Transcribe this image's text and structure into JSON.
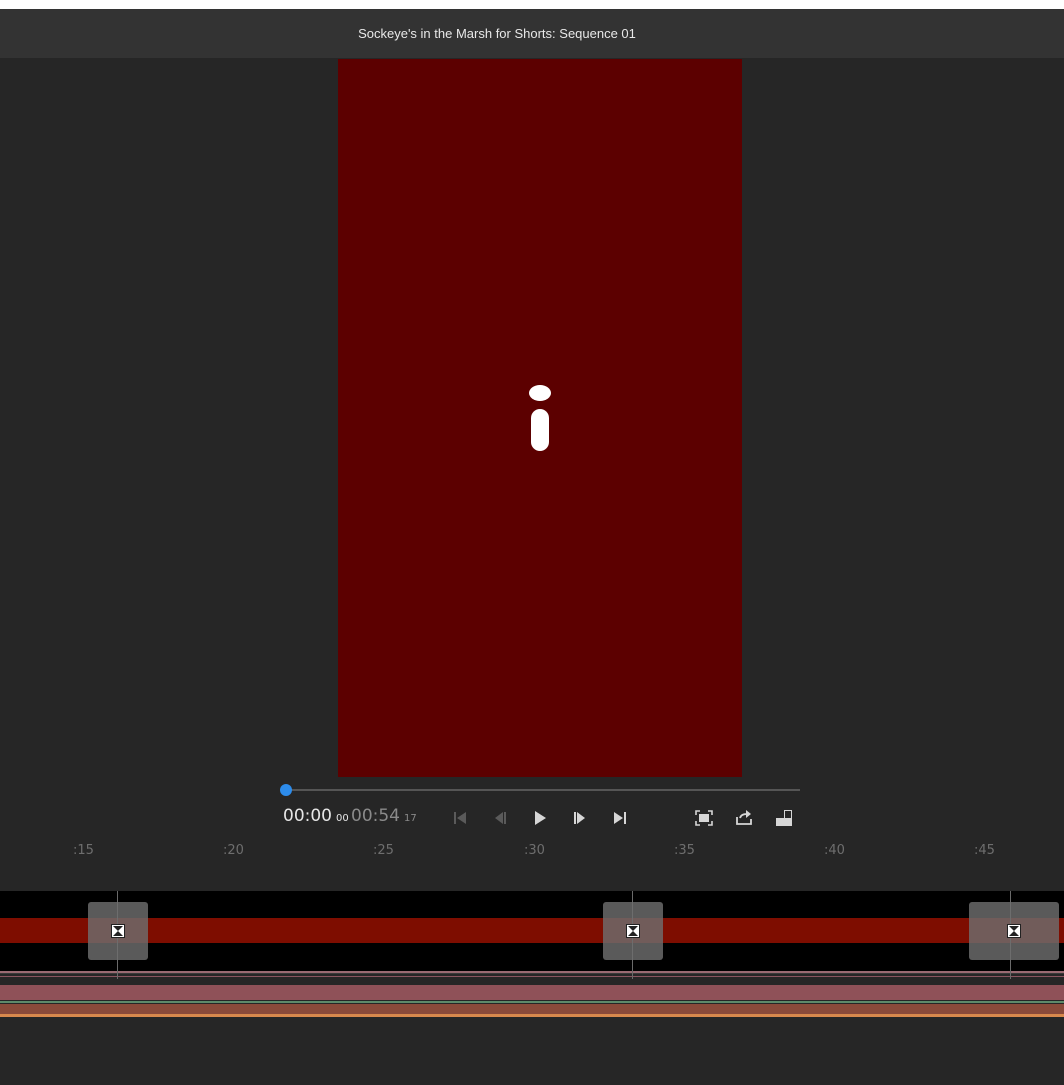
{
  "window": {
    "title": "Sockeye's in the Marsh for Shorts: Sequence 01"
  },
  "preview": {
    "background_color": "#5c0000",
    "icon": "info-letter-i-icon"
  },
  "playback": {
    "current_time": "00:00",
    "current_frames": "00",
    "duration_time": "00:54",
    "duration_frames": "17",
    "progress": 0,
    "accent_color": "#2d8ceb"
  },
  "controls": {
    "icons": [
      "skip-to-start-icon",
      "step-back-icon",
      "play-icon",
      "step-forward-icon",
      "skip-to-end-icon",
      "fit-frame-icon",
      "share-export-icon",
      "quality-settings-icon"
    ]
  },
  "timeline": {
    "ruler_labels": [
      ":15",
      ":20",
      ":25",
      ":30",
      ":35",
      ":40",
      ":45"
    ],
    "track_color": "#7e0d00",
    "transitions": [
      {
        "icon": "transition-icon"
      },
      {
        "icon": "transition-icon"
      },
      {
        "icon": "transition-icon"
      }
    ]
  }
}
